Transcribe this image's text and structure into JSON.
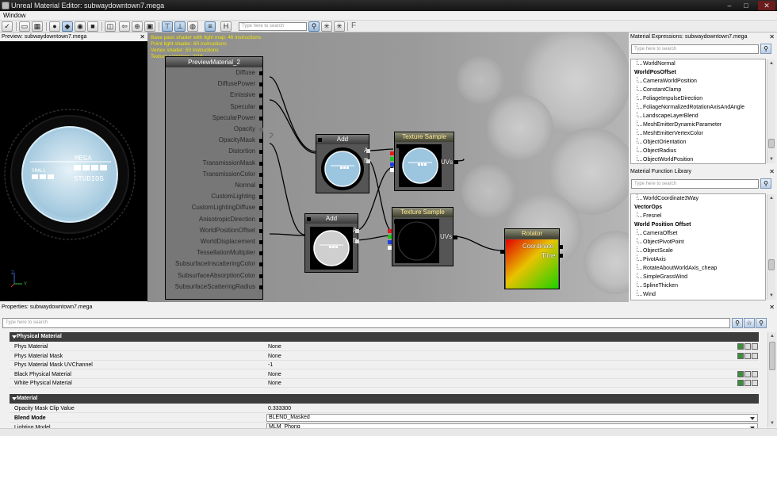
{
  "window": {
    "title": "Unreal Material Editor: subwaydowntown7.mega",
    "min": "–",
    "max": "□",
    "close": "✕"
  },
  "menu": {
    "window": "Window"
  },
  "toolbar": {
    "search_placeholder": "Type here to search",
    "icons": [
      "apply-check-icon",
      "home-icon",
      "grid-icon",
      "sphere-icon",
      "box-icon",
      "cylinder-icon",
      "plane-icon",
      "navigate-back-icon",
      "navigate-forward-icon",
      "select-icon",
      "stats-icon",
      "realtime-icon",
      "hide-connectors-icon",
      "preview-icon",
      "toggle-comments-icon",
      "hlsl-icon",
      "find-icon",
      "expression-icon",
      "function-icon"
    ],
    "glyphs": {
      "check": "✓",
      "back": "⇦",
      "fwd": "⇨",
      "find": "⚲",
      "font": "F"
    }
  },
  "preview": {
    "title": "Preview: subwaydowntown7.mega",
    "logo_top": "MEGA",
    "logo_bottom": "STUDIOS",
    "logo_small": "SMALL",
    "axes": {
      "z": "Z",
      "y": "Y"
    }
  },
  "graph": {
    "stats": [
      "Base pass shader with light map: 46 instructions",
      "Point light shader: 60 instructions",
      "Vertex shader: 50 instructions",
      "Texture samplers: 2/16"
    ],
    "main_node": {
      "title": "PreviewMaterial_2",
      "inputs": [
        "Diffuse",
        "DiffusePower",
        "Emissive",
        "Specular",
        "SpecularPower",
        "Opacity",
        "OpacityMask",
        "Distortion",
        "TransmissionMask",
        "TransmissionColor",
        "Normal",
        "CustomLighting",
        "CustomLightingDiffuse",
        "AnisotropicDirection",
        "WorldPositionOffset",
        "WorldDisplacement",
        "TessellationMultiplier",
        "SubsurfaceInscatteringColor",
        "SubsurfaceAbsorptionColor",
        "SubsurfaceScatteringRadius"
      ]
    },
    "add_node_1": {
      "title": "Add",
      "in_a": "A",
      "in_b": "B"
    },
    "add_node_2": {
      "title": "Add",
      "in_a": "A",
      "in_b": "B"
    },
    "texture_sample_1": {
      "title": "Texture Sample",
      "uvs": "UVs"
    },
    "texture_sample_2": {
      "title": "Texture Sample",
      "uvs": "UVs"
    },
    "rotator": {
      "title": "Rotator",
      "coordinate": "Coordinate",
      "time": "Time"
    }
  },
  "expressions": {
    "title": "Material Expressions: subwaydowntown7.mega",
    "search_placeholder": "Type here to search",
    "items": [
      {
        "label": "WorldNormal",
        "group": false
      },
      {
        "label": "WorldPosOffset",
        "group": true
      },
      {
        "label": "CameraWorldPosition",
        "group": false
      },
      {
        "label": "ConstantClamp",
        "group": false
      },
      {
        "label": "FoliageImpulseDirection",
        "group": false
      },
      {
        "label": "FoliageNormalizedRotationAxisAndAngle",
        "group": false
      },
      {
        "label": "LandscapeLayerBlend",
        "group": false
      },
      {
        "label": "MeshEmitterDynamicParameter",
        "group": false
      },
      {
        "label": "MeshEmitterVertexColor",
        "group": false
      },
      {
        "label": "ObjectOrientation",
        "group": false
      },
      {
        "label": "ObjectRadius",
        "group": false
      },
      {
        "label": "ObjectWorldPosition",
        "group": false
      }
    ]
  },
  "functions": {
    "title": "Material Function Library",
    "search_placeholder": "Type here to search",
    "items": [
      {
        "label": "WorldCoordinate3Way",
        "group": false
      },
      {
        "label": "VectorOps",
        "group": true
      },
      {
        "label": "Fresnel",
        "group": false
      },
      {
        "label": "World Position Offset",
        "group": true
      },
      {
        "label": "CameraOffset",
        "group": false
      },
      {
        "label": "ObjectPivotPoint",
        "group": false
      },
      {
        "label": "ObjectScale",
        "group": false
      },
      {
        "label": "PivotAxis",
        "group": false
      },
      {
        "label": "RotateAboutWorldAxis_cheap",
        "group": false
      },
      {
        "label": "SimpleGrassWind",
        "group": false
      },
      {
        "label": "SplineThicken",
        "group": false
      },
      {
        "label": "Wind",
        "group": false
      }
    ]
  },
  "properties": {
    "title": "Properties: subwaydowntown7.mega",
    "search_placeholder": "Type here to search",
    "cat_physical": "Physical Material",
    "cat_material": "Material",
    "physical_rows": [
      {
        "name": "Phys Material",
        "value": "None",
        "icons": true
      },
      {
        "name": "Phys Material Mask",
        "value": "None",
        "icons": true
      },
      {
        "name": "Phys Material Mask UVChannel",
        "value": "-1",
        "icons": false
      },
      {
        "name": "Black Physical Material",
        "value": "None",
        "icons": true
      },
      {
        "name": "White Physical Material",
        "value": "None",
        "icons": true
      }
    ],
    "opacity_clip": {
      "name": "Opacity Mask Clip Value",
      "value": "0.333300"
    },
    "blend_mode": {
      "name": "Blend Mode",
      "value": "BLEND_Masked"
    },
    "lighting_model": {
      "name": "Lighting Model",
      "value": "MLM_Phong"
    }
  }
}
